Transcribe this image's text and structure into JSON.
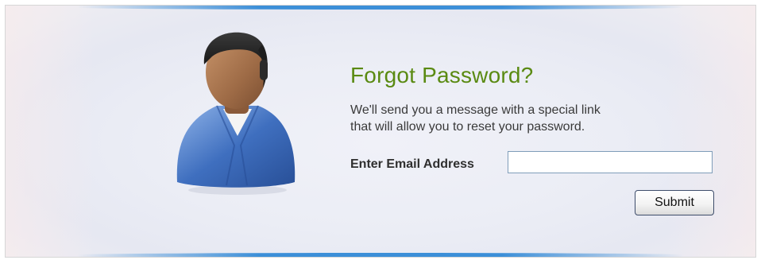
{
  "form": {
    "title": "Forgot Password?",
    "description_line1": "We'll send you a message with a special link",
    "description_line2": "that will allow you to reset your password.",
    "email_label": "Enter Email Address",
    "email_value": "",
    "submit_label": "Submit"
  },
  "icons": {
    "avatar": "user-avatar-icon"
  },
  "colors": {
    "title": "#5a8a12",
    "accent_glow": "#3c8fd8",
    "shirt": "#3f6fbf"
  }
}
